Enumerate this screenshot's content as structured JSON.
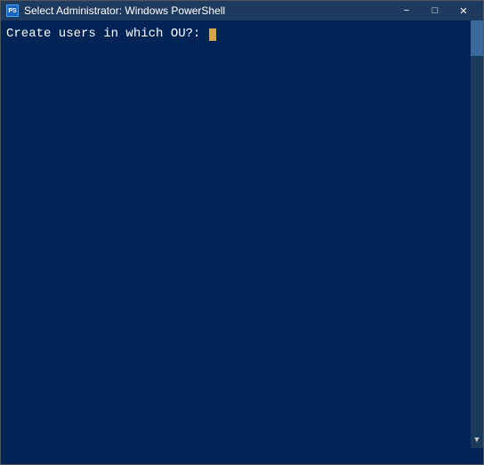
{
  "titlebar": {
    "title": "Select Administrator: Windows PowerShell",
    "ps_icon_label": "PS",
    "minimize_label": "−",
    "maximize_label": "□",
    "close_label": "✕"
  },
  "console": {
    "prompt_text": "Create users in which OU?: "
  }
}
